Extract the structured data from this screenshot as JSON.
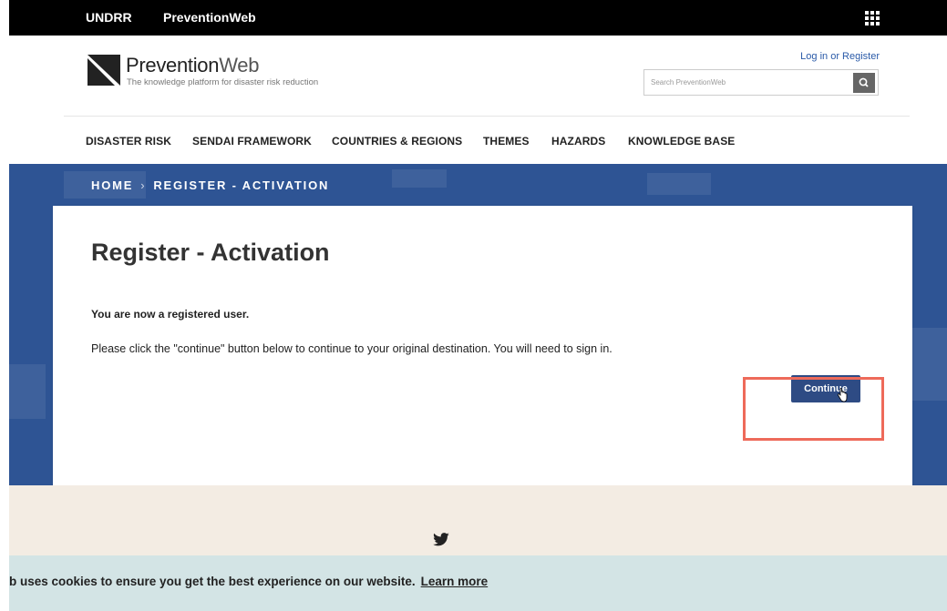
{
  "topbar": {
    "brand_primary": "UNDRR",
    "brand_secondary": "PreventionWeb",
    "apps_icon": "grid-icon"
  },
  "header": {
    "logo_name_prefix": "Prevention",
    "logo_name_suffix": "Web",
    "tagline": "The knowledge platform for disaster risk reduction",
    "login_link": "Log in or Register",
    "search_placeholder": "Search PreventionWeb",
    "search_icon": "search-icon"
  },
  "nav": {
    "items": [
      {
        "label": "DISASTER RISK"
      },
      {
        "label": "SENDAI FRAMEWORK"
      },
      {
        "label": "COUNTRIES & REGIONS"
      },
      {
        "label": "THEMES"
      },
      {
        "label": "HAZARDS"
      },
      {
        "label": "KNOWLEDGE BASE"
      }
    ]
  },
  "breadcrumb": {
    "home": "HOME",
    "current": "REGISTER - ACTIVATION"
  },
  "content": {
    "title": "Register - Activation",
    "message_strong": "You are now a registered user.",
    "message_body": "Please click the \"continue\" button below to continue to your original destination. You will need to sign in.",
    "continue_label": "Continue"
  },
  "colors": {
    "hero_blue": "#2e5494",
    "button_blue": "#2e4b84",
    "highlight": "#ee6a5a",
    "cookie_bg": "#d3e4e5",
    "beige": "#f3ece3"
  },
  "footer": {
    "social_icon": "twitter-icon"
  },
  "cookie": {
    "text": "b uses cookies to ensure you get the best experience on our website.",
    "link": "Learn more"
  }
}
